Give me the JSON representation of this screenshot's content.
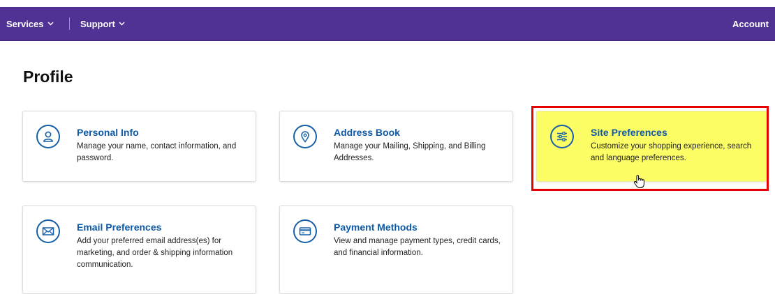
{
  "topbar": {
    "services_label": "Services",
    "support_label": "Support",
    "account_label": "Account",
    "bg_color": "#4f3293"
  },
  "page": {
    "title": "Profile"
  },
  "cards": {
    "personal_info": {
      "title": "Personal Info",
      "description": "Manage your name, contact information, and password.",
      "icon": "person-icon"
    },
    "address_book": {
      "title": "Address Book",
      "description": "Manage your Mailing, Shipping, and Billing Addresses.",
      "icon": "location-pin-icon"
    },
    "site_preferences": {
      "title": "Site Preferences",
      "description": "Customize your shopping experience, search and language preferences.",
      "icon": "sliders-icon",
      "highlighted": true,
      "highlight_color": "#fdfd66",
      "outline_color": "#e60000"
    },
    "email_preferences": {
      "title": "Email Preferences",
      "description": "Add your preferred email address(es) for marketing, and order & shipping information communication.",
      "icon": "envelope-icon"
    },
    "payment_methods": {
      "title": "Payment Methods",
      "description": "View and manage payment types, credit cards, and financial information.",
      "icon": "credit-card-icon"
    }
  },
  "colors": {
    "link_blue": "#0e5aa7"
  }
}
